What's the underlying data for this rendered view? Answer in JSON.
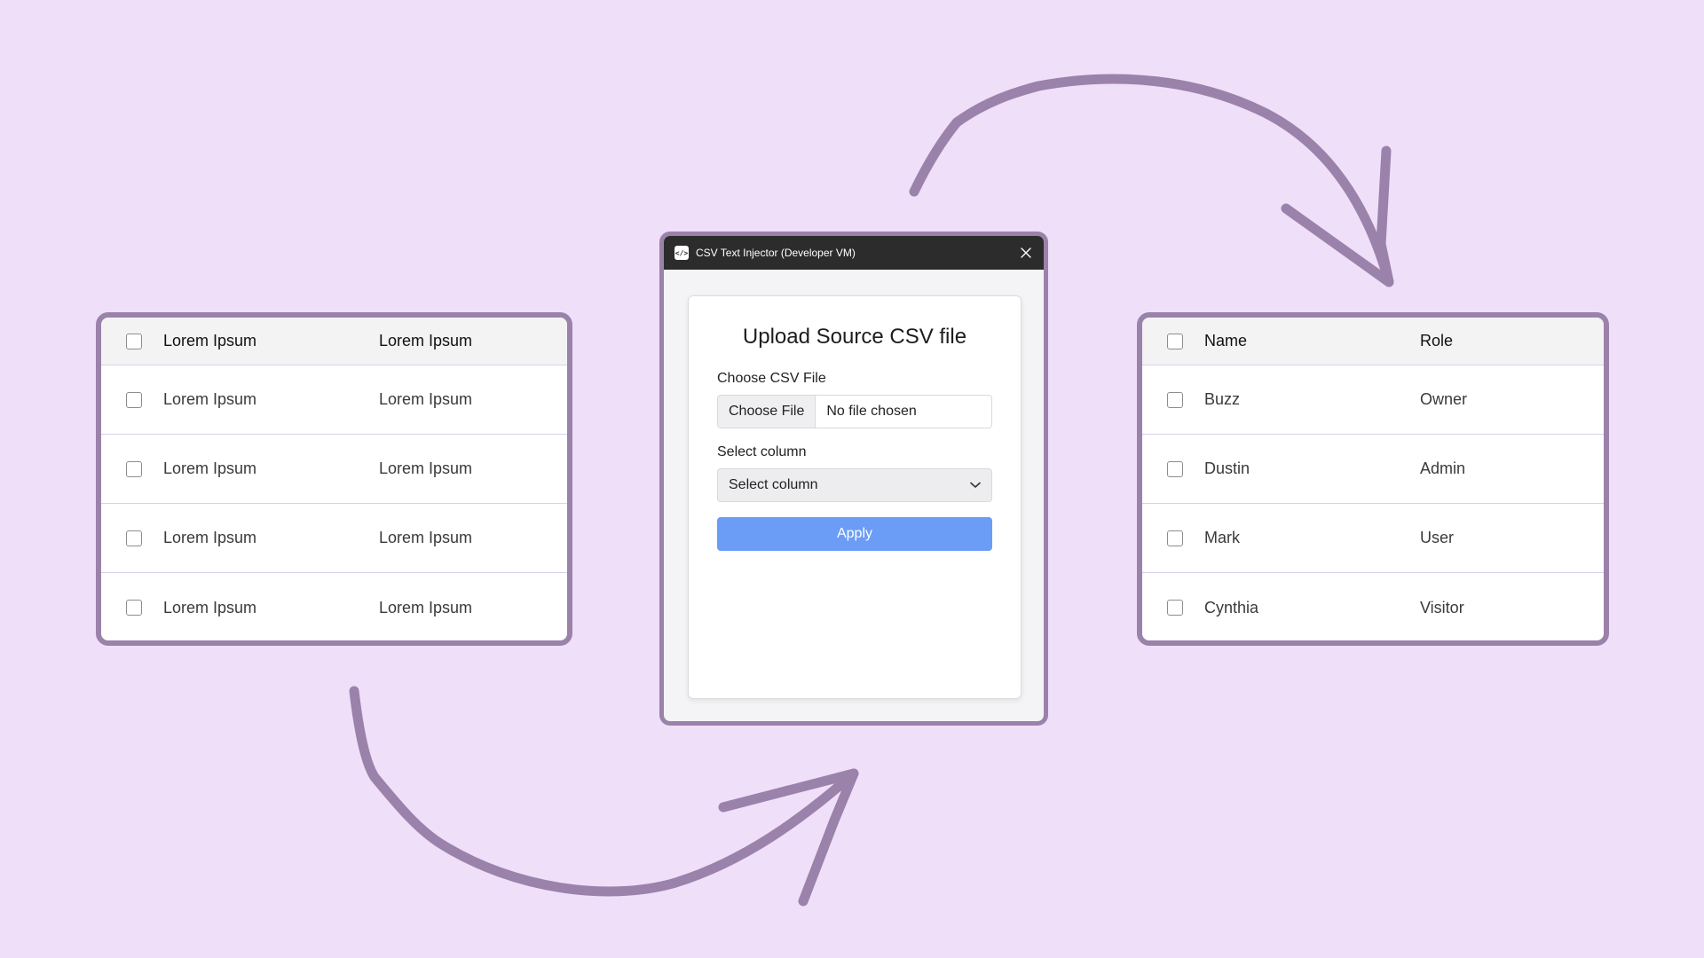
{
  "colors": {
    "background": "#efdff8",
    "frame": "#9a82aa",
    "arrow": "#9a82aa",
    "titlebar": "#2c2c2c",
    "apply_button": "#6b9cf6"
  },
  "left_table": {
    "headers": [
      "Lorem Ipsum",
      "Lorem Ipsum"
    ],
    "rows": [
      [
        "Lorem Ipsum",
        "Lorem Ipsum"
      ],
      [
        "Lorem Ipsum",
        "Lorem Ipsum"
      ],
      [
        "Lorem Ipsum",
        "Lorem Ipsum"
      ],
      [
        "Lorem Ipsum",
        "Lorem Ipsum"
      ]
    ]
  },
  "dialog": {
    "title": "CSV Text Injector (Developer VM)",
    "app_icon": "code-icon",
    "close_icon": "close-icon",
    "heading": "Upload Source CSV file",
    "file_label": "Choose CSV File",
    "file_button": "Choose File",
    "file_status": "No file chosen",
    "column_label": "Select column",
    "column_select_value": "Select column",
    "apply_label": "Apply"
  },
  "right_table": {
    "headers": [
      "Name",
      "Role"
    ],
    "rows": [
      [
        "Buzz",
        "Owner"
      ],
      [
        "Dustin",
        "Admin"
      ],
      [
        "Mark",
        "User"
      ],
      [
        "Cynthia",
        "Visitor"
      ]
    ]
  }
}
